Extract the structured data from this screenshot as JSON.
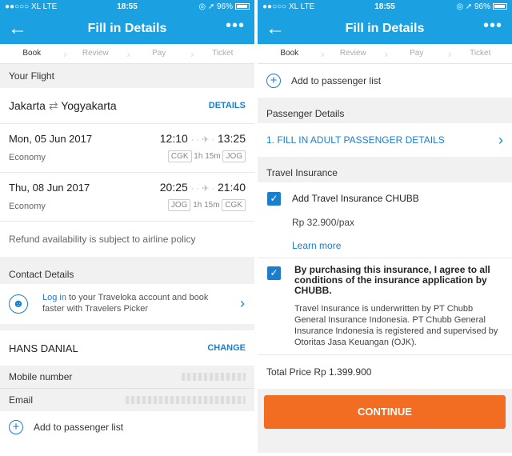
{
  "status": {
    "carrier": "XL",
    "network": "LTE",
    "time": "18:55",
    "battery": "96%"
  },
  "appbar": {
    "title": "Fill in Details",
    "back_icon": "arrow-left",
    "more_icon": "more-dots"
  },
  "steps": [
    "Book",
    "Review",
    "Pay",
    "Ticket"
  ],
  "left": {
    "your_flight_header": "Your Flight",
    "route": {
      "from": "Jakarta",
      "swap": "⇄",
      "to": "Yogyakarta",
      "details_label": "DETAILS"
    },
    "flights": [
      {
        "date": "Mon, 05 Jun 2017",
        "depart": "12:10",
        "arrive": "13:25",
        "cabin": "Economy",
        "origin": "CGK",
        "duration": "1h 15m",
        "dest": "JOG"
      },
      {
        "date": "Thu, 08 Jun 2017",
        "depart": "20:25",
        "arrive": "21:40",
        "cabin": "Economy",
        "origin": "JOG",
        "duration": "1h 15m",
        "dest": "CGK"
      }
    ],
    "refund_note": "Refund availability is subject to airline policy",
    "contact_header": "Contact Details",
    "login": {
      "link": "Log in",
      "text": " to your Traveloka account and book faster with Travelers Picker"
    },
    "contact_name": "HANS DANIAL",
    "change_label": "CHANGE",
    "mobile_label": "Mobile number",
    "email_label": "Email",
    "add_passenger": "Add to passenger list"
  },
  "right": {
    "add_passenger": "Add to passenger list",
    "passenger_header": "Passenger Details",
    "fill_adult": "1. FILL IN ADULT PASSENGER DETAILS",
    "insurance_header": "Travel Insurance",
    "insurance_add": "Add Travel Insurance CHUBB",
    "insurance_price": "Rp 32.900/pax",
    "learn_more": "Learn more",
    "agree_text": "By purchasing this insurance, I agree to all conditions of the insurance application by CHUBB.",
    "underwriter_text": "Travel Insurance is underwritten by PT Chubb General Insurance Indonesia. PT Chubb General Insurance Indonesia is registered and supervised by Otoritas Jasa Keuangan (OJK).",
    "total_price": "Total Price Rp 1.399.900",
    "continue_label": "CONTINUE"
  },
  "colors": {
    "brand": "#1ba0e2",
    "link": "#1b7ecc",
    "cta": "#f26d21"
  }
}
